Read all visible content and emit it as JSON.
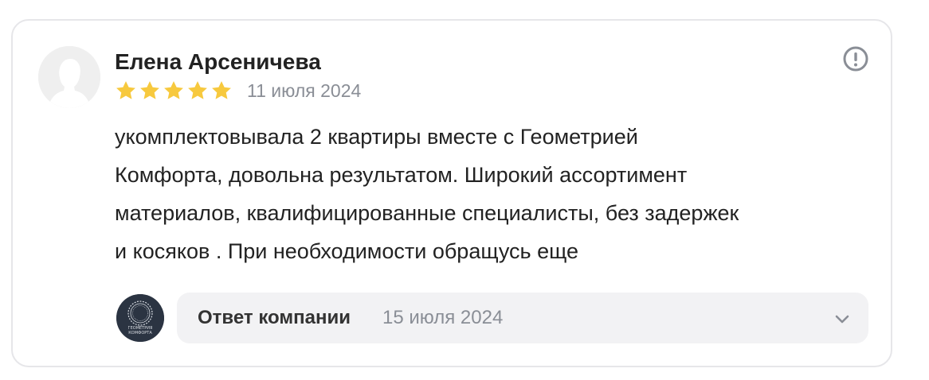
{
  "review": {
    "author_name": "Елена Арсеничева",
    "rating": 5,
    "rating_max": 5,
    "star_color": "#f7c93e",
    "date": "11 июля 2024",
    "text_lines": [
      "укомплектовывала 2 квартиры вместе с Геометрией",
      "Комфорта, довольна результатом. Широкий ассортимент",
      "материалов, квалифицированные специалисты, без задержек",
      "и косяков . При необходимости обращусь еще"
    ],
    "avatar_icon": "default-user-silhouette-icon",
    "report_icon": "exclamation-circle-icon"
  },
  "company_reply": {
    "label": "Ответ компании",
    "date": "15 июля 2024",
    "logo_text_line1": "ГЕОМЕТРИЯ",
    "logo_text_line2": "КОМФОРТА",
    "logo_bg_color": "#2b3442",
    "expand_icon": "chevron-down-icon"
  }
}
